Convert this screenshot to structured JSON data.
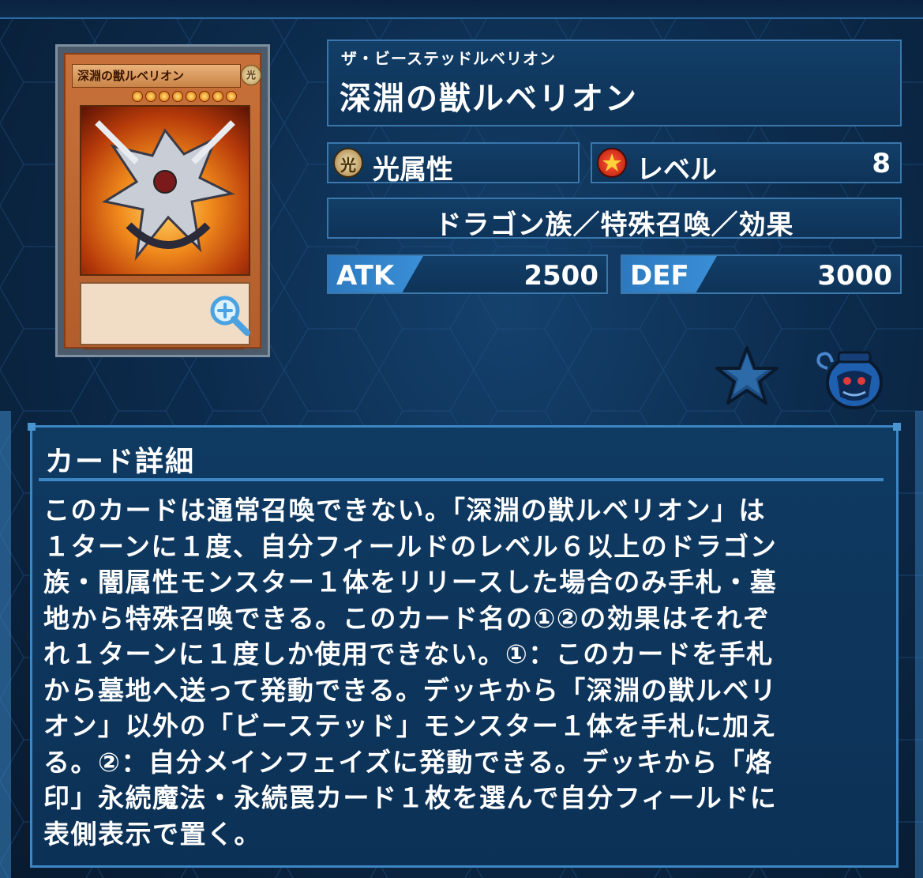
{
  "card": {
    "name_on_card": "深淵の獣ルベリオン",
    "attribute_symbol": "光",
    "level_stars": 8,
    "zoom_icon": "magnifier-plus-icon"
  },
  "header": {
    "kana": "ザ・ビーステッドルベリオン",
    "name": "深淵の獣ルベリオン"
  },
  "attribute": {
    "icon_char": "光",
    "label": "光属性"
  },
  "level": {
    "label": "レベル",
    "value": "8"
  },
  "type_line": "ドラゴン族／特殊召喚／効果",
  "stats": {
    "atk_label": "ATK",
    "atk_value": "2500",
    "def_label": "DEF",
    "def_value": "3000"
  },
  "actions": {
    "favorite_icon": "star-icon",
    "pot_icon": "pot-of-greed-icon"
  },
  "details": {
    "title": "カード詳細",
    "lines": [
      "このカードは通常召喚できない。「深淵の獣ルベリオン」は",
      "１ターンに１度、自分フィールドのレベル６以上のドラゴン",
      "族・闇属性モンスター１体をリリースした場合のみ手札・墓",
      "地から特殊召喚できる。このカード名の①②の効果はそれぞ",
      "れ１ターンに１度しか使用できない。①：このカードを手札",
      "から墓地へ送って発動できる。デッキから「深淵の獣ルベリ",
      "オン」以外の「ビーステッド」モンスター１体を手札に加え",
      "る。②：自分メインフェイズに発動できる。デッキから「烙",
      "印」永続魔法・永続罠カード１枚を選んで自分フィールドに",
      "表側表示で置く。"
    ]
  },
  "colors": {
    "panel_border": "#3a77ac",
    "panel_fill": "#123e67",
    "stat_label": "#3a8fd6",
    "background": "#0c2b4c"
  }
}
